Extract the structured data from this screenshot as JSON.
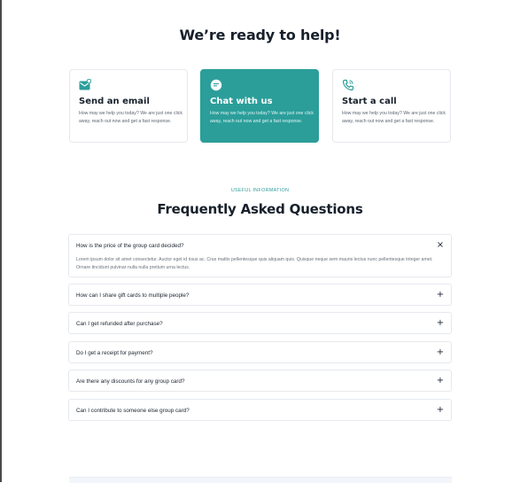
{
  "page": {
    "title": "We’re ready to help!"
  },
  "colors": {
    "accent": "#2b9e9a",
    "text_dark": "#17202b",
    "border": "#e6e9ee"
  },
  "contact_cards": [
    {
      "icon": "email-icon",
      "title": "Send an email",
      "text": "How may we help you today? We are just one click away, reach out now and get a fast response."
    },
    {
      "icon": "chat-icon",
      "title": "Chat with us",
      "text": "How may we help you today? We are just one click away, reach out now and get a fast response."
    },
    {
      "icon": "phone-icon",
      "title": "Start a call",
      "text": "How may we help you today? We are just one click away, reach out now and get a fast response."
    }
  ],
  "faq": {
    "eyebrow": "USEFUL INFORMATION",
    "title": "Frequently Asked Questions",
    "items": [
      {
        "question": "How is the price of the group card decided?",
        "answer": "Lorem ipsum dolor sit amet consectetur. Auctor eget id risus ac. Cras mattis pellentesque quis aliquam quis. Quisque neque sem mauris lectus nunc pellentesque integer amet. Ornare tincidunt pulvinar nulla nulla pretium urna lectus.",
        "toggle": "×",
        "expanded": true
      },
      {
        "question": "How can I share gift cards to multiple people?",
        "toggle": "+",
        "expanded": false
      },
      {
        "question": "Can I get refunded after purchase?",
        "toggle": "+",
        "expanded": false
      },
      {
        "question": "Do I get a receipt for payment?",
        "toggle": "+",
        "expanded": false
      },
      {
        "question": "Are there any discounts for any group card?",
        "toggle": "+",
        "expanded": false
      },
      {
        "question": "Can I contribute to someone else group card?",
        "toggle": "+",
        "expanded": false
      }
    ]
  }
}
